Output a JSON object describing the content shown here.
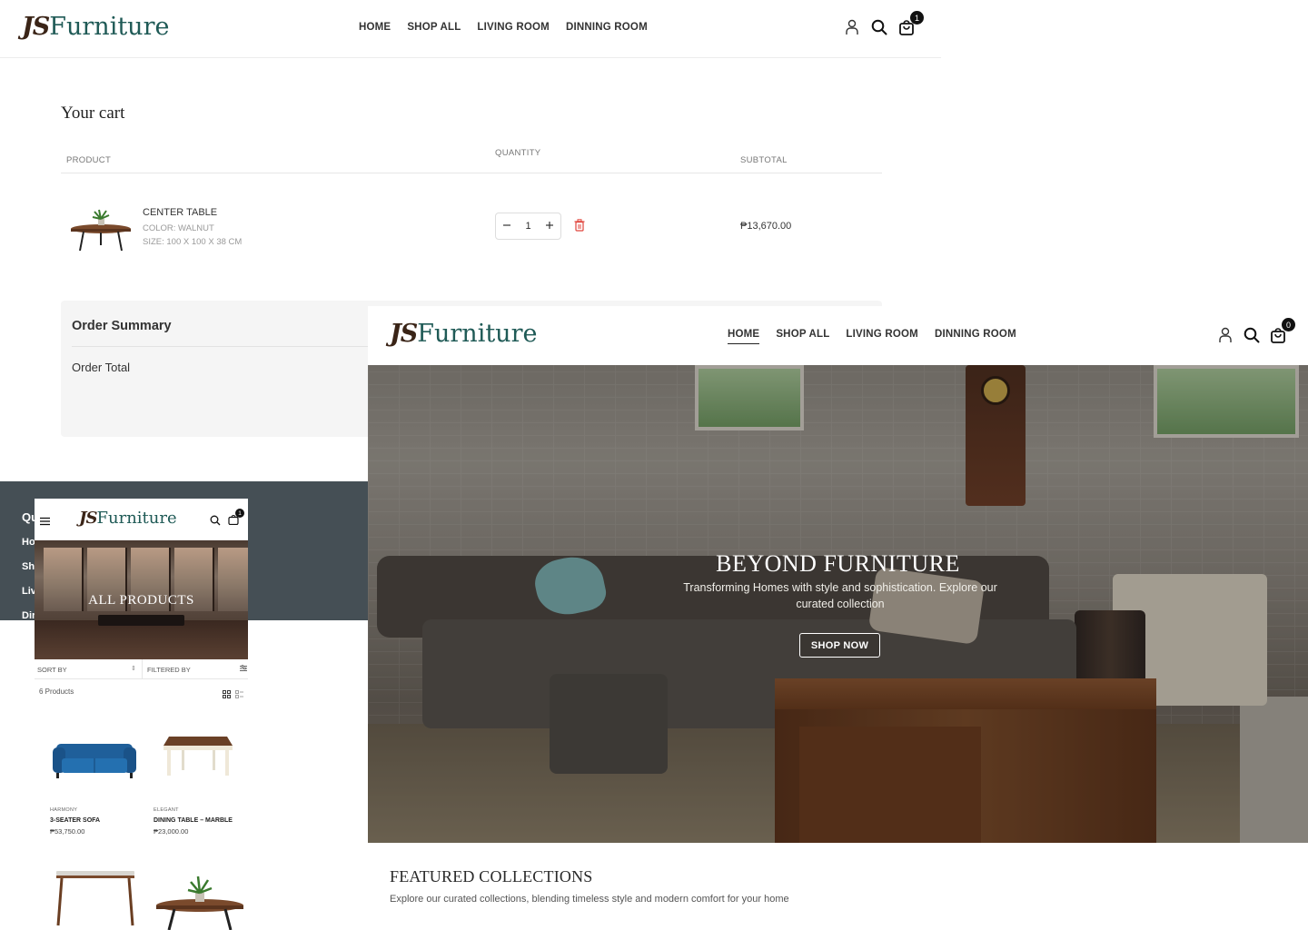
{
  "cart_page": {
    "logo": {
      "js": "JS",
      "text": "Furniture"
    },
    "nav": [
      "HOME",
      "SHOP ALL",
      "LIVING ROOM",
      "DINNING ROOM"
    ],
    "cart_count": "1",
    "title": "Your cart",
    "columns": {
      "product": "PRODUCT",
      "quantity": "QUANTITY",
      "subtotal": "SUBTOTAL"
    },
    "item": {
      "name": "CENTER TABLE",
      "color": "COLOR: WALNUT",
      "size": "SIZE: 100 X 100 X 38 CM",
      "quantity": "1",
      "subtotal": "₱13,670.00"
    },
    "order_summary": {
      "title": "Order Summary",
      "total_label": "Order Total"
    },
    "footer": {
      "title": "Qu",
      "links": [
        "Ho",
        "Sh",
        "Liv",
        "Dir"
      ]
    }
  },
  "mobile": {
    "logo": {
      "js": "JS",
      "text": "Furniture"
    },
    "cart_count": "1",
    "hero_title": "ALL PRODUCTS",
    "sort_label": "SORT BY",
    "filter_label": "FILTERED BY",
    "count_label": "6 Products",
    "products": [
      {
        "brand": "HARMONY",
        "name": "3-SEATER SOFA",
        "price": "₱53,750.00"
      },
      {
        "brand": "ELEGANT",
        "name": "DINING TABLE – MARBLE",
        "price": "₱23,000.00"
      }
    ]
  },
  "home": {
    "logo": {
      "js": "JS",
      "text": "Furniture"
    },
    "nav": [
      "HOME",
      "SHOP ALL",
      "LIVING ROOM",
      "DINNING ROOM"
    ],
    "active_nav": "HOME",
    "cart_count": "0",
    "hero": {
      "title": "BEYOND FURNITURE",
      "subtitle": "Transforming Homes with style and sophistication. Explore our curated collection",
      "button": "SHOP NOW"
    },
    "featured": {
      "title": "FEATURED COLLECTIONS",
      "subtitle": "Explore our curated collections, blending timeless style and modern comfort for your home"
    }
  },
  "colors": {
    "logo_dark": "#3a2417",
    "logo_teal": "#1f5a56",
    "footer_bg": "#454f55",
    "delete_red": "#e0443c",
    "sofa_blue": "#1f5f9a"
  },
  "icons": [
    "user-icon",
    "search-icon",
    "cart-icon",
    "minus-icon",
    "plus-icon",
    "trash-icon",
    "hamburger-icon",
    "grid-view-icon",
    "list-view-icon",
    "filter-icon",
    "sort-arrows-icon"
  ]
}
